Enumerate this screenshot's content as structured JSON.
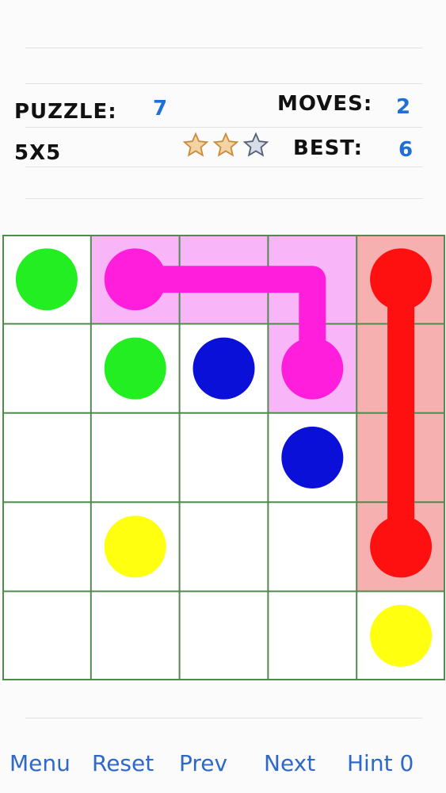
{
  "header": {
    "puzzle_label": "PUZZLE:",
    "puzzle_number": "7",
    "moves_label": "MOVES:",
    "moves_value": "2",
    "size_label": "5X5",
    "best_label": "BEST:",
    "best_value": "6",
    "stars": [
      {
        "icon": "star-filled-icon",
        "filled": true
      },
      {
        "icon": "star-filled-icon",
        "filled": true
      },
      {
        "icon": "star-empty-icon",
        "filled": false
      }
    ]
  },
  "board": {
    "rows": 5,
    "cols": 5,
    "grid_color": "#4f8a4f",
    "colors": {
      "green": "#22ee22",
      "magenta": "#ff1edc",
      "blue": "#0a10d8",
      "red": "#ff1010",
      "yellow": "#ffff10"
    },
    "fills": {
      "magenta": "#f8b6f8",
      "red": "#f6b0b0"
    },
    "dots": [
      {
        "color": "green",
        "row": 0,
        "col": 0
      },
      {
        "color": "green",
        "row": 1,
        "col": 1
      },
      {
        "color": "magenta",
        "row": 0,
        "col": 1
      },
      {
        "color": "magenta",
        "row": 1,
        "col": 3
      },
      {
        "color": "blue",
        "row": 1,
        "col": 2
      },
      {
        "color": "blue",
        "row": 2,
        "col": 3
      },
      {
        "color": "red",
        "row": 0,
        "col": 4
      },
      {
        "color": "red",
        "row": 3,
        "col": 4
      },
      {
        "color": "yellow",
        "row": 3,
        "col": 1
      },
      {
        "color": "yellow",
        "row": 4,
        "col": 4
      }
    ],
    "paths": [
      {
        "color": "magenta",
        "cells": [
          [
            0,
            1
          ],
          [
            0,
            2
          ],
          [
            0,
            3
          ],
          [
            1,
            3
          ]
        ]
      },
      {
        "color": "red",
        "cells": [
          [
            0,
            4
          ],
          [
            1,
            4
          ],
          [
            2,
            4
          ],
          [
            3,
            4
          ]
        ]
      }
    ]
  },
  "toolbar": {
    "menu": "Menu",
    "reset": "Reset",
    "prev": "Prev",
    "next": "Next",
    "hint": "Hint",
    "hint_count": "0"
  }
}
